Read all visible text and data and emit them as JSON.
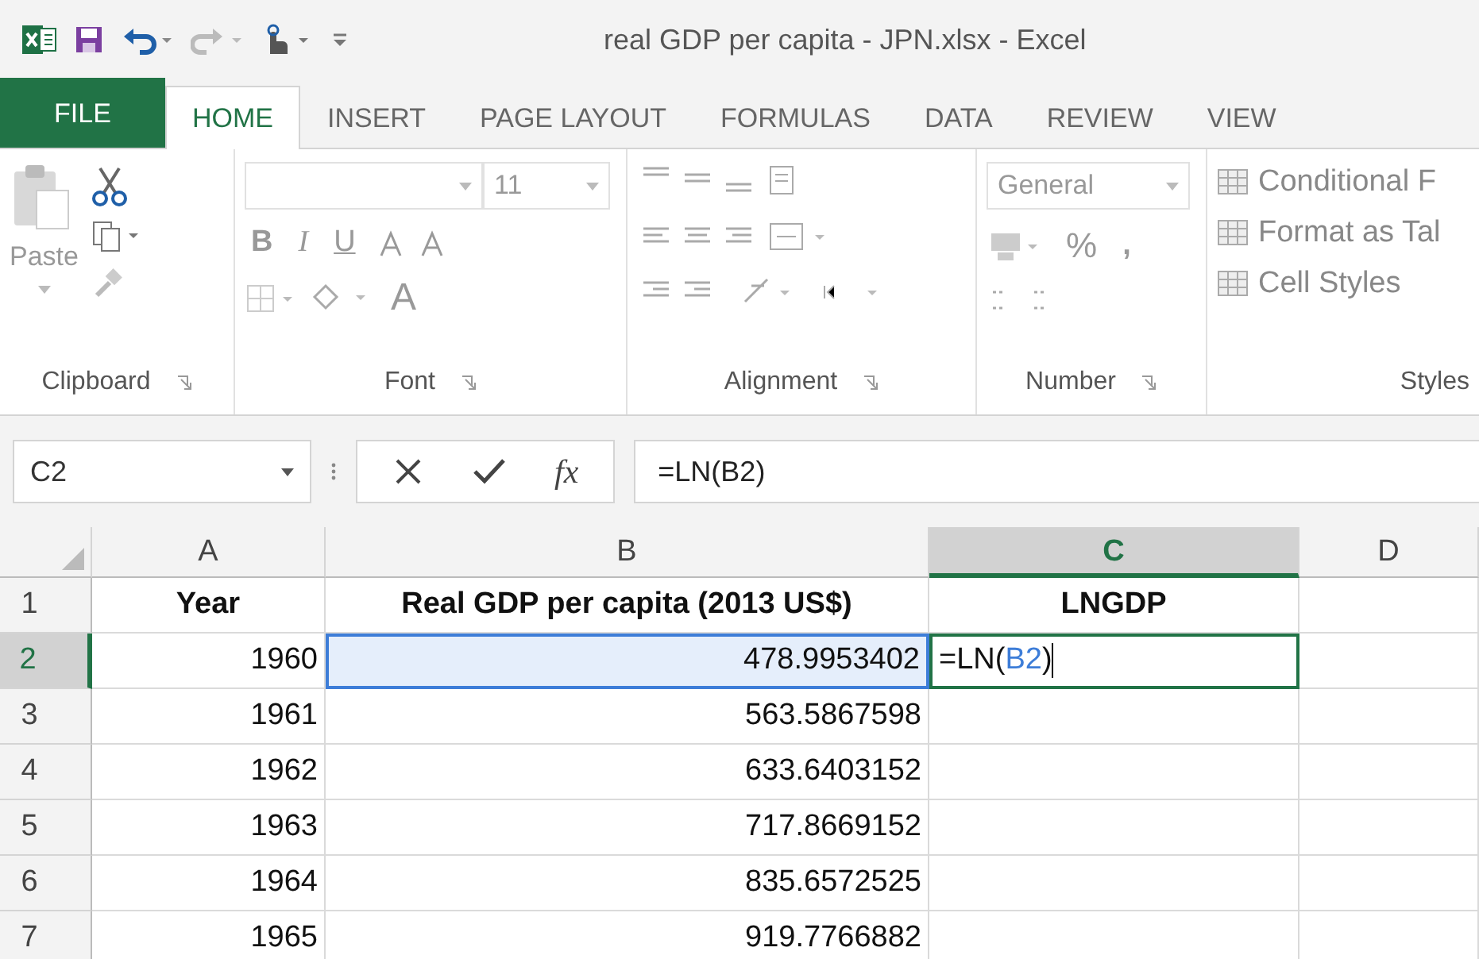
{
  "window": {
    "title": "real GDP per capita - JPN.xlsx - Excel"
  },
  "tabs": [
    {
      "label": "FILE",
      "kind": "file",
      "selected": false
    },
    {
      "label": "HOME",
      "kind": "tab",
      "selected": true
    },
    {
      "label": "INSERT",
      "kind": "tab",
      "selected": false
    },
    {
      "label": "PAGE LAYOUT",
      "kind": "tab",
      "selected": false
    },
    {
      "label": "FORMULAS",
      "kind": "tab",
      "selected": false
    },
    {
      "label": "DATA",
      "kind": "tab",
      "selected": false
    },
    {
      "label": "REVIEW",
      "kind": "tab",
      "selected": false
    },
    {
      "label": "VIEW",
      "kind": "tab",
      "selected": false
    }
  ],
  "ribbon": {
    "paste_label": "Paste",
    "font_size": "11",
    "bold": "B",
    "italic": "I",
    "underline": "U",
    "font_color": "A",
    "number_format": "General",
    "percent": "%",
    "comma": ",",
    "styles": [
      "Conditional F",
      "Format as Tal",
      "Cell Styles"
    ],
    "groups": [
      "Clipboard",
      "Font",
      "Alignment",
      "Number",
      "Styles"
    ]
  },
  "name_box": "C2",
  "fx": "fx",
  "formula": "=LN(B2)",
  "columns": [
    {
      "label": "A",
      "selected": false
    },
    {
      "label": "B",
      "selected": false
    },
    {
      "label": "C",
      "selected": true
    },
    {
      "label": "D",
      "selected": false
    }
  ],
  "rows": [
    {
      "label": "1",
      "selected": false,
      "cells": [
        {
          "text": "Year",
          "kind": "header"
        },
        {
          "text": "Real GDP per capita (2013 US$)",
          "kind": "header"
        },
        {
          "text": "LNGDP",
          "kind": "header"
        },
        {
          "kind": "empty"
        }
      ]
    },
    {
      "label": "2",
      "selected": true,
      "cells": [
        {
          "text": "1960",
          "kind": "number"
        },
        {
          "text": "478.9953402",
          "kind": "reference"
        },
        {
          "kind": "editing",
          "parts": [
            {
              "text": "=LN(",
              "kind": "plain"
            },
            {
              "text": "B2",
              "kind": "ref"
            },
            {
              "text": ")",
              "kind": "plain"
            }
          ]
        },
        {
          "kind": "empty"
        }
      ]
    },
    {
      "label": "3",
      "selected": false,
      "cells": [
        {
          "text": "1961",
          "kind": "number"
        },
        {
          "text": "563.5867598",
          "kind": "number"
        },
        {
          "kind": "empty"
        },
        {
          "kind": "empty"
        }
      ]
    },
    {
      "label": "4",
      "selected": false,
      "cells": [
        {
          "text": "1962",
          "kind": "number"
        },
        {
          "text": "633.6403152",
          "kind": "number"
        },
        {
          "kind": "empty"
        },
        {
          "kind": "empty"
        }
      ]
    },
    {
      "label": "5",
      "selected": false,
      "cells": [
        {
          "text": "1963",
          "kind": "number"
        },
        {
          "text": "717.8669152",
          "kind": "number"
        },
        {
          "kind": "empty"
        },
        {
          "kind": "empty"
        }
      ]
    },
    {
      "label": "6",
      "selected": false,
      "cells": [
        {
          "text": "1964",
          "kind": "number"
        },
        {
          "text": "835.6572525",
          "kind": "number"
        },
        {
          "kind": "empty"
        },
        {
          "kind": "empty"
        }
      ]
    },
    {
      "label": "7",
      "selected": false,
      "cells": [
        {
          "text": "1965",
          "kind": "number"
        },
        {
          "text": "919.7766882",
          "kind": "number"
        },
        {
          "kind": "empty"
        },
        {
          "kind": "empty"
        }
      ]
    }
  ]
}
